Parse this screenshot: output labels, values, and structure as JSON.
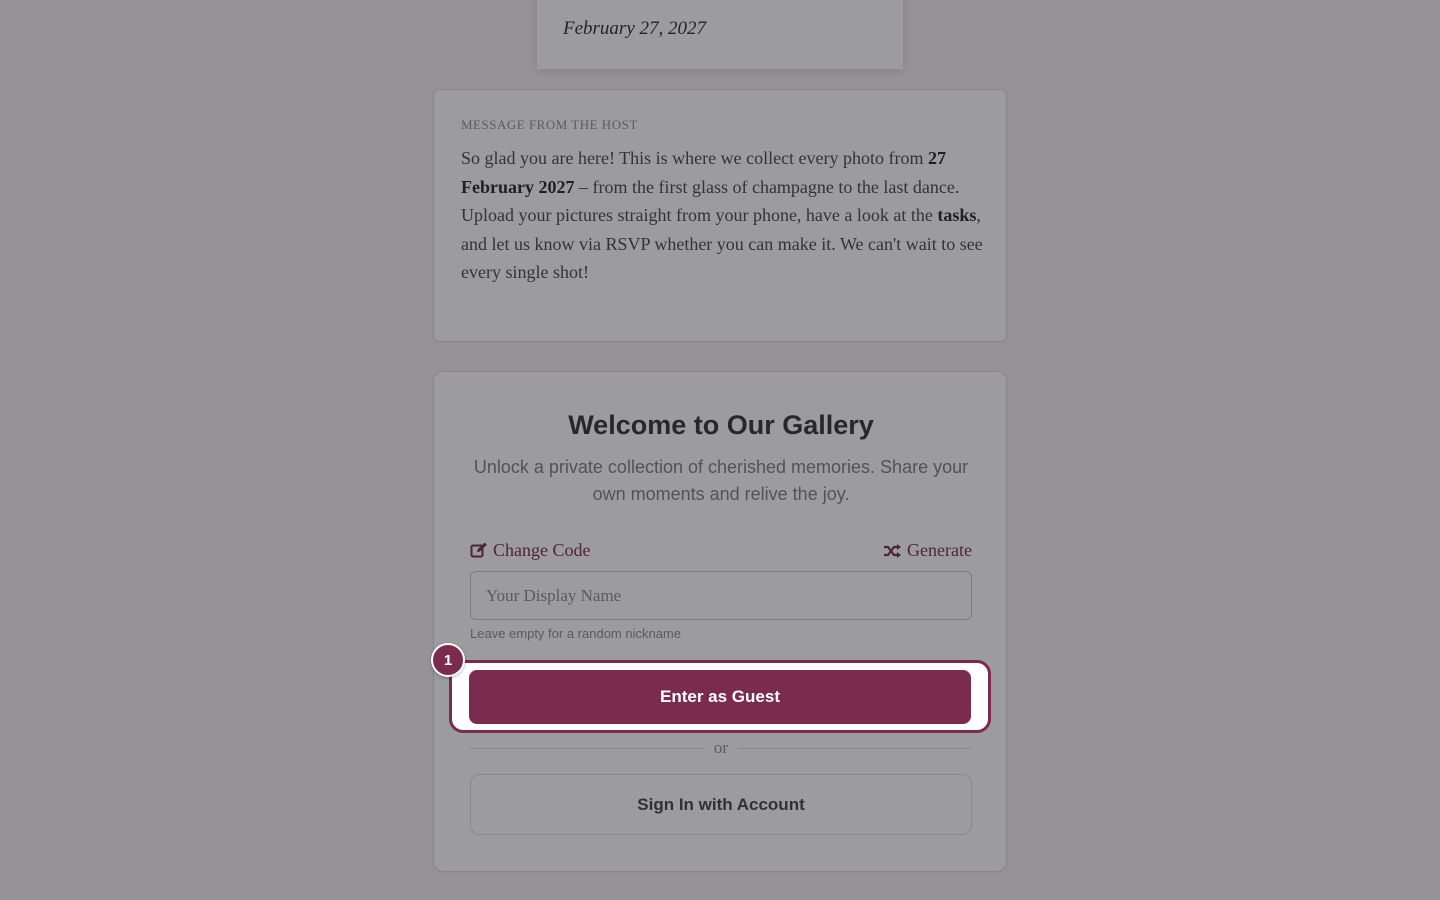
{
  "event": {
    "date": "February 27, 2027"
  },
  "host_message": {
    "label": "MESSAGE FROM THE HOST",
    "para1_start": "So glad you are here! This is where we collect every photo from ",
    "para1_bold": "27 February 2027",
    "para1_end": " – from the first glass of champagne to the last dance.",
    "para2_start": "Upload your pictures straight from your phone, have a look at the ",
    "para2_bold": "tasks",
    "para2_end": ", and let us know via RSVP whether you can make it. We can't wait to see every single shot!"
  },
  "welcome": {
    "title": "Welcome to Our Gallery",
    "subtitle": "Unlock a private collection of cherished memories. Share your own moments and relive the joy.",
    "change_code_label": "Change Code",
    "generate_label": "Generate",
    "name_placeholder": "Your Display Name",
    "name_value": "",
    "hint": "Leave empty for a random nickname",
    "guest_button_label": "Enter as Guest",
    "divider_label": "or",
    "signin_button_label": "Sign In with Account"
  },
  "tour": {
    "step_number": "1"
  },
  "colors": {
    "accent": "#7b2b4d",
    "background": "#f4f1f4",
    "overlay": "rgba(40, 36, 44, 0.46)"
  },
  "icons": {
    "change_code": "edit-icon",
    "generate": "shuffle-icon"
  }
}
